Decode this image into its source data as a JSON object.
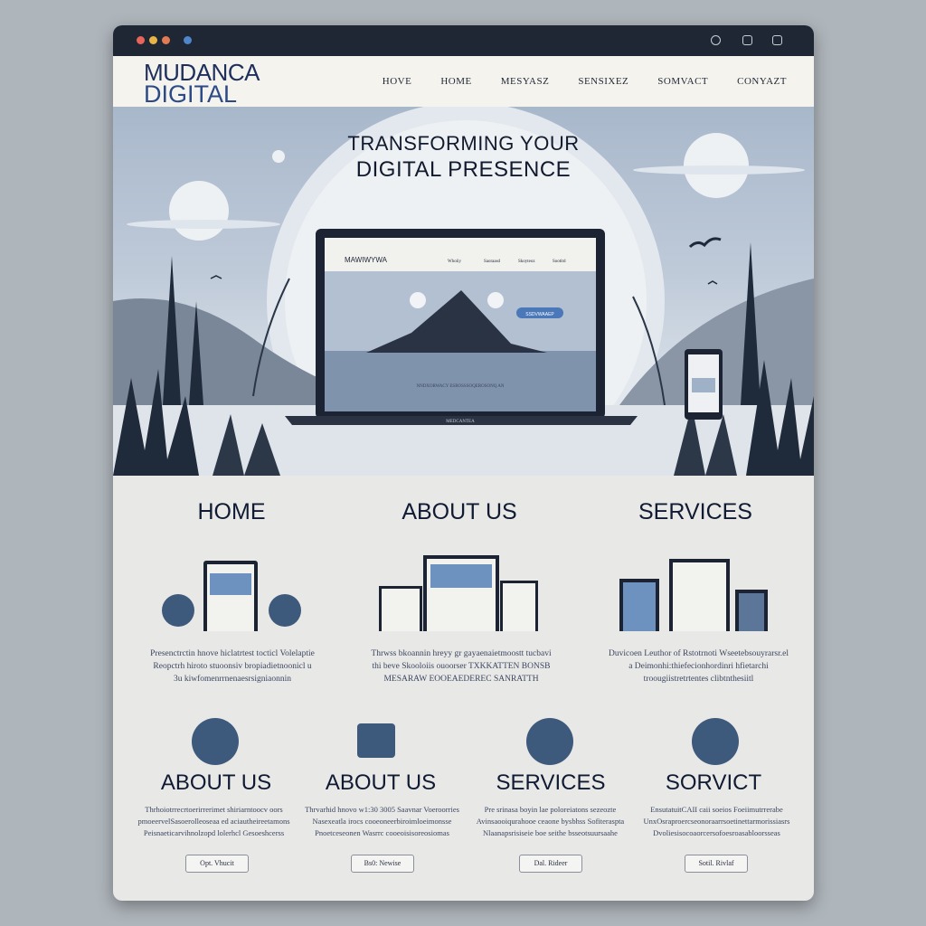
{
  "brand": {
    "line1": "MUDANCA",
    "line2": "DIGITAL"
  },
  "nav": [
    "HOVE",
    "HOME",
    "MESYASZ",
    "SENSIXEZ",
    "SOMVACT",
    "CONYAZT"
  ],
  "hero": {
    "title_line1": "TRANSFORMING YOUR",
    "title_line2": "DIGITAL PRESENCE",
    "laptop_logo": "MAWIWYWA",
    "laptop_nav": [
      "Whoiiy",
      "Saoraasd",
      "Skoyteoz",
      "Sootitd"
    ],
    "laptop_button": "SSDVWAAEP",
    "laptop_caption": "NNDXORWACY ESROSSSOQEROSONQ AN",
    "laptop_brand": "MEDCANTEA"
  },
  "sections": [
    {
      "title": "HOME",
      "desc": [
        "Presenctrctin hnove hiclatrtest tocticl Volelaptie",
        "Reopctrh hiroto stuoonsiv bropiadietnoonicl u",
        "3u kiwfomenrrnenaesrsigniaonnin"
      ]
    },
    {
      "title": "ABOUT US",
      "desc": [
        "Thrwss bkoannin hreyy gr gayaenaietmoostt tucbavi",
        "thi beve Skooloiis ouoorser TXKKATTEN BONSB",
        "MESARAW EOOEAEDEREC SANRATTH"
      ]
    },
    {
      "title": "SERVICES",
      "desc": [
        "Duvicoen Leuthor of Rstotrnoti Wseetebsouyrarsr.el",
        "a Deimonhi:thiefecionhordinri hfietarchi",
        "troougiistretrtentes clibtnthesiitl"
      ]
    }
  ],
  "services": [
    {
      "title": "ABOUT US",
      "icon": "grid-icon",
      "desc": [
        "Thrhoiotrrecrtoerirrerimet shiriarntoocv oors",
        "pmoeervelSasoerolleoseaa ed aciautheireetamons",
        "Peisnaeticarvihnolzopd lolerhcl Gesoeshcerss"
      ],
      "button": "Opt. Vhucit"
    },
    {
      "title": "ABOUT US",
      "icon": "window-icon",
      "desc": [
        "Thrvarhid hnovo w1:30 3005 Saavnar Voeroorries",
        "Nasexeatla irocs cooeoneerbiroimloeimonsse",
        "Pnoetceseonen Wasrrc cooeoisisoreosiomas"
      ],
      "button": "Bs0: Newise"
    },
    {
      "title": "SERVICES",
      "icon": "briefcase-icon",
      "desc": [
        "Pre srinasa boyin lae poloreiatons sezeozte",
        "Avinsaooiqurahooe ceaone bysbhss Sofiteraspta",
        "Nlaanapsrisiseie boe seithe bsseotsuursaahe"
      ],
      "button": "Dal. Rideer"
    },
    {
      "title": "SORVICT",
      "icon": "edit-icon",
      "desc": [
        "EnsutatuitCAII caii soeios Foeiimutrrerabe",
        "UnxOsraproercseonoraarrsoetinettarmorissiasrs",
        "Dvoliesisocoaorcersofoesroasabloorsseas"
      ],
      "button": "Sotil. Rivlaf"
    }
  ],
  "colors": {
    "chrome": "#1f2735",
    "accent": "#3d5a7c",
    "brand": "#1f2f5b"
  }
}
